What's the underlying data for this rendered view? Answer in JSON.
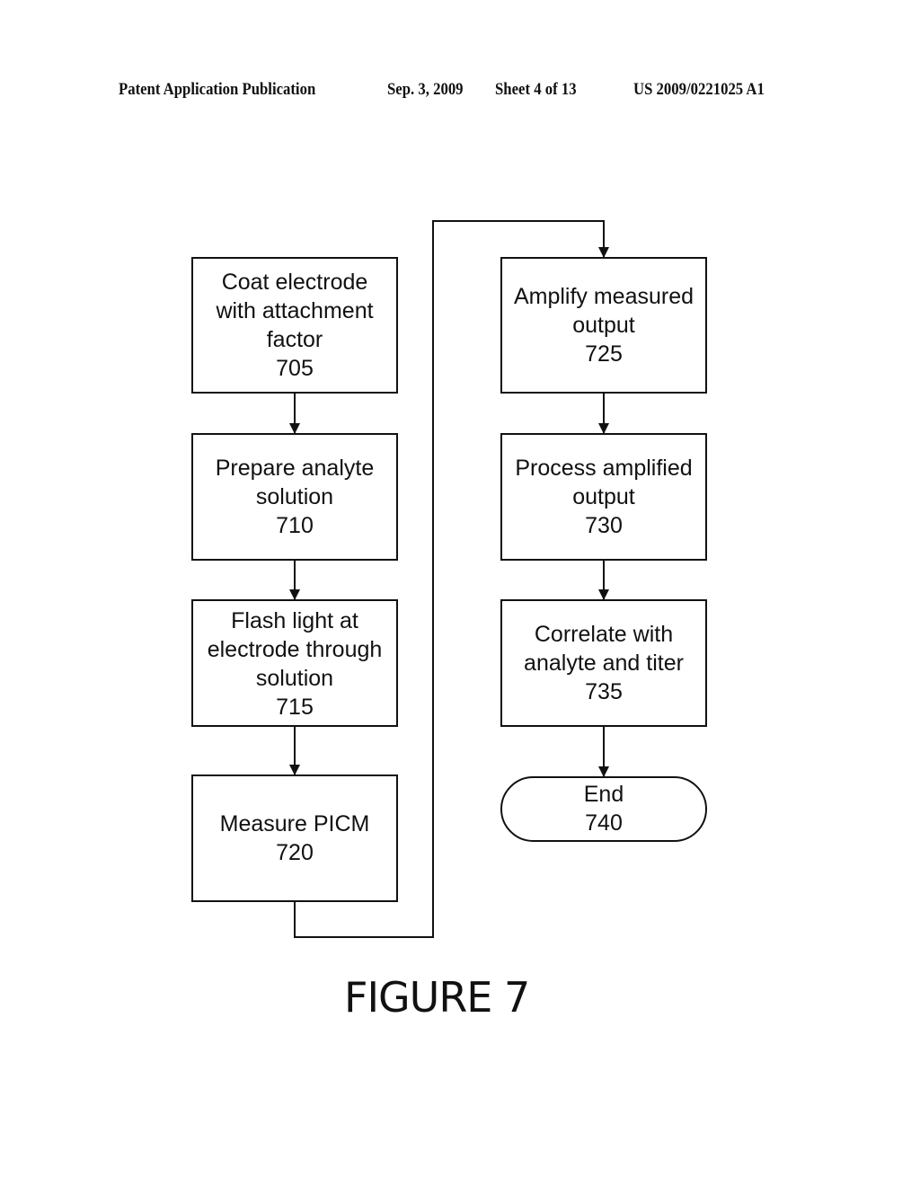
{
  "header": {
    "publication": "Patent Application Publication",
    "date": "Sep. 3, 2009",
    "sheet": "Sheet 4 of 13",
    "number": "US 2009/0221025 A1"
  },
  "flowchart": {
    "steps": [
      {
        "id": "705",
        "lines": [
          "Coat electrode",
          "with attachment",
          "factor",
          "705"
        ],
        "shape": "rectangle"
      },
      {
        "id": "710",
        "lines": [
          "Prepare analyte",
          "solution",
          "710"
        ],
        "shape": "rectangle"
      },
      {
        "id": "715",
        "lines": [
          "Flash light at",
          "electrode through",
          "solution",
          "715"
        ],
        "shape": "rectangle"
      },
      {
        "id": "720",
        "lines": [
          "Measure PICM",
          "720"
        ],
        "shape": "rectangle"
      },
      {
        "id": "725",
        "lines": [
          "Amplify measured",
          "output",
          "725"
        ],
        "shape": "rectangle"
      },
      {
        "id": "730",
        "lines": [
          "Process amplified",
          "output",
          "730"
        ],
        "shape": "rectangle"
      },
      {
        "id": "735",
        "lines": [
          "Correlate with",
          "analyte and titer",
          "735"
        ],
        "shape": "rectangle"
      },
      {
        "id": "740",
        "lines": [
          "End",
          "740"
        ],
        "shape": "terminator"
      }
    ],
    "edges": [
      [
        "705",
        "710"
      ],
      [
        "710",
        "715"
      ],
      [
        "715",
        "720"
      ],
      [
        "720",
        "725"
      ],
      [
        "725",
        "730"
      ],
      [
        "730",
        "735"
      ],
      [
        "735",
        "740"
      ]
    ]
  },
  "figure_label": "FIGURE 7"
}
